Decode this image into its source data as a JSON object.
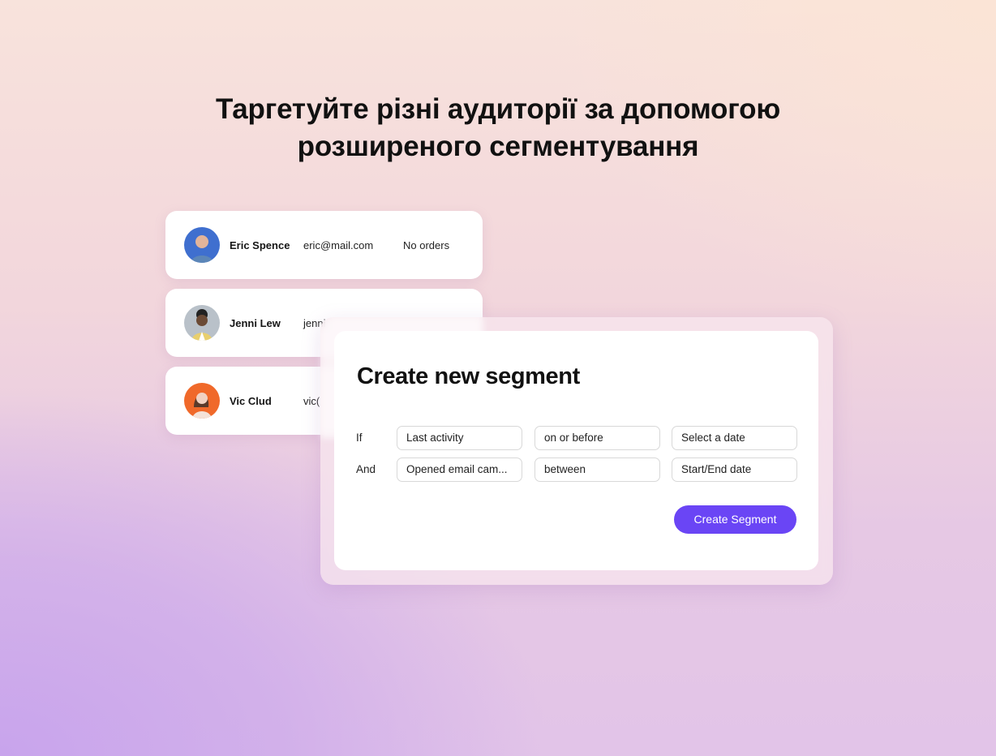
{
  "headline": {
    "line1": "Таргетуйте різні аудиторії за допомогою",
    "line2": "розширеного сегментування"
  },
  "contacts": [
    {
      "name": "Eric Spence",
      "email": "eric@mail.com",
      "orders": "No orders",
      "avatar_color": "#3f6fcf"
    },
    {
      "name": "Jenni Lew",
      "email": "jenni",
      "orders": "",
      "avatar_color": "#b9c1c9"
    },
    {
      "name": "Vic Clud",
      "email": "vic(",
      "orders": "",
      "avatar_color": "#f0692a"
    }
  ],
  "segment_panel": {
    "title": "Create new segment",
    "conditions": [
      {
        "label": "If",
        "field": "Last activity",
        "operator": "on or before",
        "value": "Select a date"
      },
      {
        "label": "And",
        "field": "Opened email cam...",
        "operator": "between",
        "value": "Start/End date"
      }
    ],
    "create_button": "Create Segment",
    "accent_color": "#6a45f5"
  }
}
